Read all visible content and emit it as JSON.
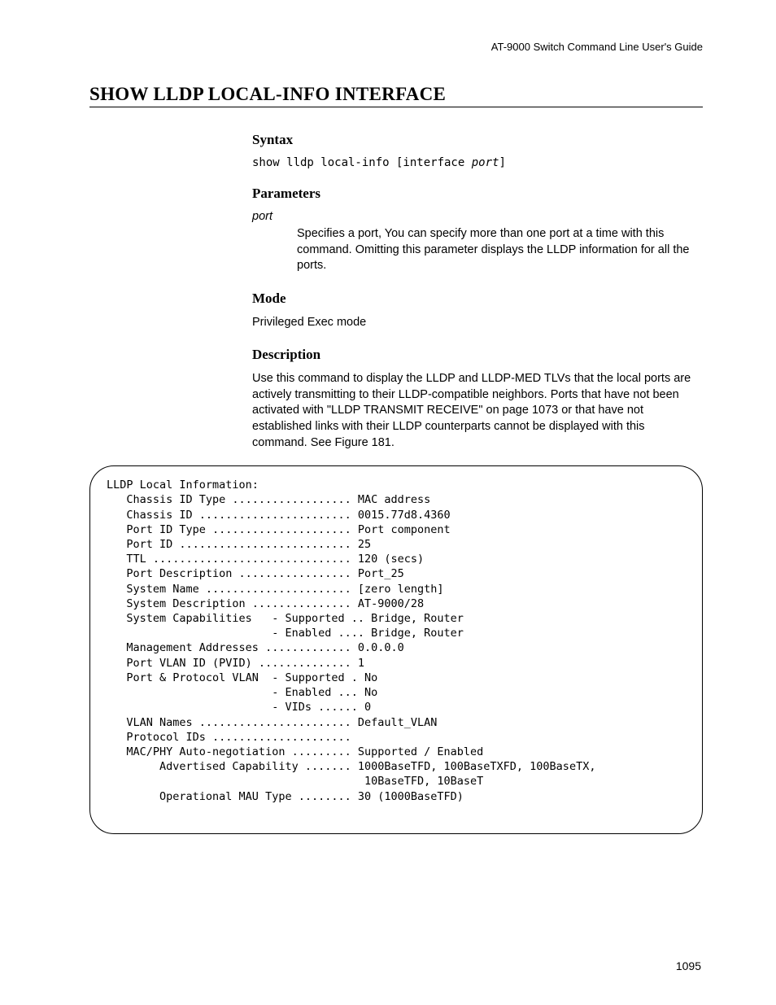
{
  "header": "AT-9000 Switch Command Line User's Guide",
  "title": "SHOW LLDP LOCAL-INFO INTERFACE",
  "sections": {
    "syntax": {
      "heading": "Syntax",
      "prefix": "show lldp local-info [interface ",
      "param": "port",
      "suffix": "]"
    },
    "parameters": {
      "heading": "Parameters",
      "param_name": "port",
      "param_desc": "Specifies a port, You can specify more than one port at a time with this command. Omitting this parameter displays the LLDP information for all the ports."
    },
    "mode": {
      "heading": "Mode",
      "text": "Privileged Exec mode"
    },
    "description": {
      "heading": "Description",
      "text": "Use this command to display the LLDP and LLDP-MED TLVs that the local ports are actively transmitting to their LLDP-compatible neighbors. Ports that have not been activated with \"LLDP TRANSMIT RECEIVE\" on page 1073 or that have not established links with their LLDP counterparts cannot be displayed with this command. See Figure 181."
    }
  },
  "output": "LLDP Local Information:\n   Chassis ID Type .................. MAC address\n   Chassis ID ....................... 0015.77d8.4360\n   Port ID Type ..................... Port component\n   Port ID .......................... 25\n   TTL .............................. 120 (secs)\n   Port Description ................. Port_25\n   System Name ...................... [zero length]\n   System Description ............... AT-9000/28\n   System Capabilities   - Supported .. Bridge, Router\n                         - Enabled .... Bridge, Router\n   Management Addresses ............. 0.0.0.0\n   Port VLAN ID (PVID) .............. 1\n   Port & Protocol VLAN  - Supported . No\n                         - Enabled ... No\n                         - VIDs ...... 0\n   VLAN Names ....................... Default_VLAN\n   Protocol IDs .....................\n   MAC/PHY Auto-negotiation ......... Supported / Enabled\n        Advertised Capability ....... 1000BaseTFD, 100BaseTXFD, 100BaseTX,\n                                       10BaseTFD, 10BaseT\n        Operational MAU Type ........ 30 (1000BaseTFD)",
  "page_number": "1095"
}
